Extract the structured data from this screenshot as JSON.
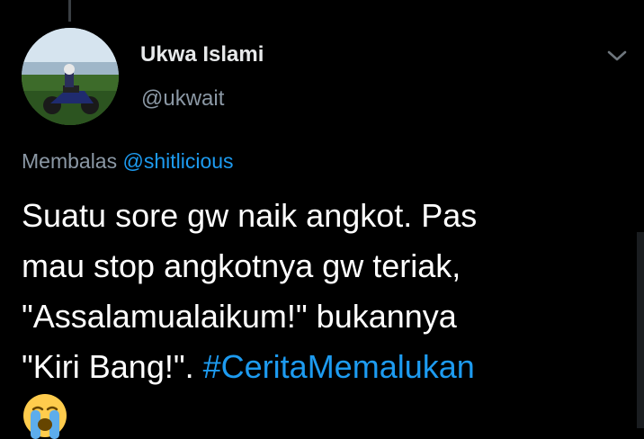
{
  "tweet": {
    "display_name": "Ukwa Islami",
    "handle": "@ukwait",
    "reply_prefix": "Membalas",
    "reply_mention": "@shitlicious",
    "text_lines": [
      "Suatu sore gw naik angkot. Pas",
      "mau stop angkotnya gw teriak,",
      "\"Assalamualaikum!\" bukannya",
      "\"Kiri Bang!\". "
    ],
    "hashtag": "#CeritaMemalukan",
    "emoji_icon": "loudly-crying-face-icon"
  },
  "colors": {
    "background": "#000000",
    "text": "#ffffff",
    "secondary_text": "#8b98a5",
    "link": "#1d9bf0"
  }
}
